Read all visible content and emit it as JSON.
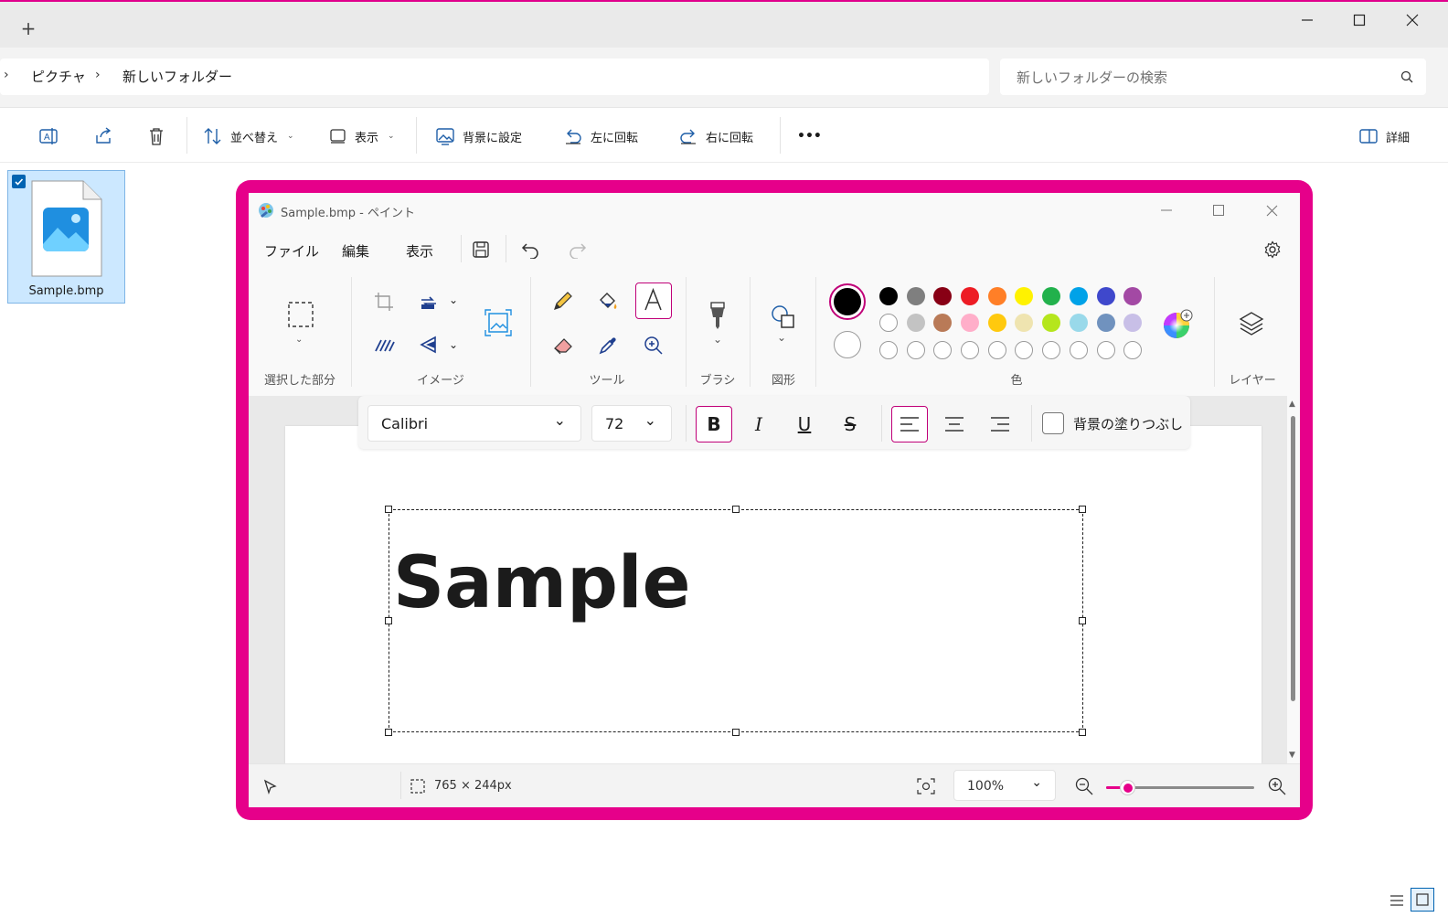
{
  "explorer": {
    "new_tab_label": "+",
    "breadcrumb": [
      "ピクチャ",
      "新しいフォルダー"
    ],
    "search_placeholder": "新しいフォルダーの検索",
    "commands": {
      "sort": "並べ替え",
      "view": "表示",
      "set_background": "背景に設定",
      "rotate_left": "左に回転",
      "rotate_right": "右に回転",
      "more": "•••",
      "details": "詳細"
    },
    "file": {
      "name": "Sample.bmp",
      "selected": true
    }
  },
  "paint": {
    "title": "Sample.bmp - ペイント",
    "menu": [
      "ファイル",
      "編集",
      "表示"
    ],
    "groups": {
      "selection": "選択した部分",
      "image": "イメージ",
      "tools": "ツール",
      "brush": "ブラシ",
      "shapes": "図形",
      "colors": "色",
      "layers": "レイヤー"
    },
    "palette": {
      "primary": "#000000",
      "secondary": "#ffffff",
      "row1": [
        "#000000",
        "#7f7f7f",
        "#880015",
        "#ed1c24",
        "#ff7f27",
        "#fff200",
        "#22b14c",
        "#00a2e8",
        "#3f48cc",
        "#a349a4"
      ],
      "row2": [
        "#ffffff",
        "#c3c3c3",
        "#b97a57",
        "#ffaec9",
        "#ffc90e",
        "#efe4b0",
        "#b5e61d",
        "#99d9ea",
        "#7092be",
        "#c8bfe7"
      ]
    },
    "text_toolbar": {
      "font": "Calibri",
      "size": "72",
      "bold_label": "B",
      "italic_label": "I",
      "underline_label": "U",
      "strike_label": "S",
      "fill_background_label": "背景の塗りつぶし"
    },
    "canvas_text": "Sample",
    "status": {
      "selection_size": "765 × 244px",
      "zoom": "100%"
    },
    "accent": "#e6008a"
  }
}
